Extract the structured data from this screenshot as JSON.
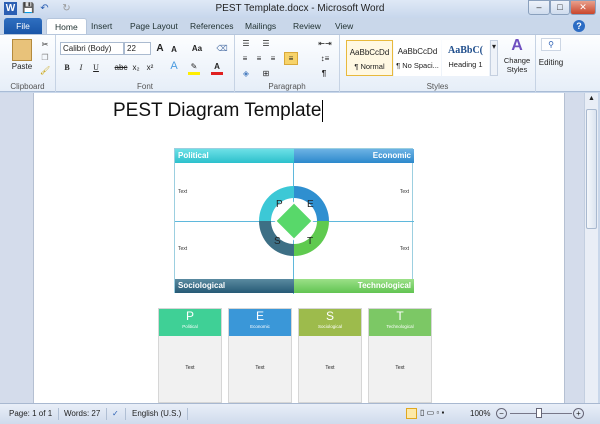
{
  "window": {
    "title": "PEST Template.docx - Microsoft Word",
    "minimize": "–",
    "maximize": "□",
    "close": "✕"
  },
  "quick_access": {
    "word_icon": "W",
    "save": "💾",
    "undo": "↶",
    "redo": "↻"
  },
  "tabs": [
    "File",
    "Home",
    "Insert",
    "Page Layout",
    "References",
    "Mailings",
    "Review",
    "View"
  ],
  "ribbon": {
    "clipboard": {
      "label": "Clipboard",
      "paste": "Paste"
    },
    "font": {
      "label": "Font",
      "family": "Calibri (Body)",
      "size": "22",
      "bold": "B",
      "italic": "I",
      "underline": "U",
      "strike": "abc",
      "sub": "x₂",
      "sup": "x²",
      "grow": "A",
      "shrink": "A",
      "case": "Aa"
    },
    "paragraph": {
      "label": "Paragraph",
      "pilcrow": "¶"
    },
    "styles": {
      "label": "Styles",
      "items": [
        {
          "preview": "AaBbCcDd",
          "name": "¶ Normal"
        },
        {
          "preview": "AaBbCcDd",
          "name": "¶ No Spaci..."
        },
        {
          "preview": "AaBbC(",
          "name": "Heading 1"
        }
      ],
      "change_styles": "Change Styles"
    },
    "editing": {
      "label": "Editing"
    }
  },
  "document": {
    "title": "PEST Diagram Template",
    "quadrants": [
      {
        "label": "Political",
        "text": "Text",
        "color": "#3cc8d0"
      },
      {
        "label": "Economic",
        "text": "Text",
        "color": "#3a95d4"
      },
      {
        "label": "Sociological",
        "text": "Text",
        "color": "#2f6680"
      },
      {
        "label": "Technological",
        "text": "Text",
        "color": "#6fcf5e"
      }
    ],
    "ring_letters": [
      "P",
      "E",
      "S",
      "T"
    ],
    "cards": [
      {
        "letter": "P",
        "label": "Political",
        "text": "Text",
        "color": "#3fd096"
      },
      {
        "letter": "E",
        "label": "Economic",
        "text": "Text",
        "color": "#3a97d8"
      },
      {
        "letter": "S",
        "label": "Sociological",
        "text": "Text",
        "color": "#9dbb4c"
      },
      {
        "letter": "T",
        "label": "Technological",
        "text": "Text",
        "color": "#7cc865"
      }
    ]
  },
  "status": {
    "page": "Page: 1 of 1",
    "words": "Words: 27",
    "language": "English (U.S.)",
    "zoom": "100%",
    "zoom_out": "−",
    "zoom_in": "+"
  }
}
